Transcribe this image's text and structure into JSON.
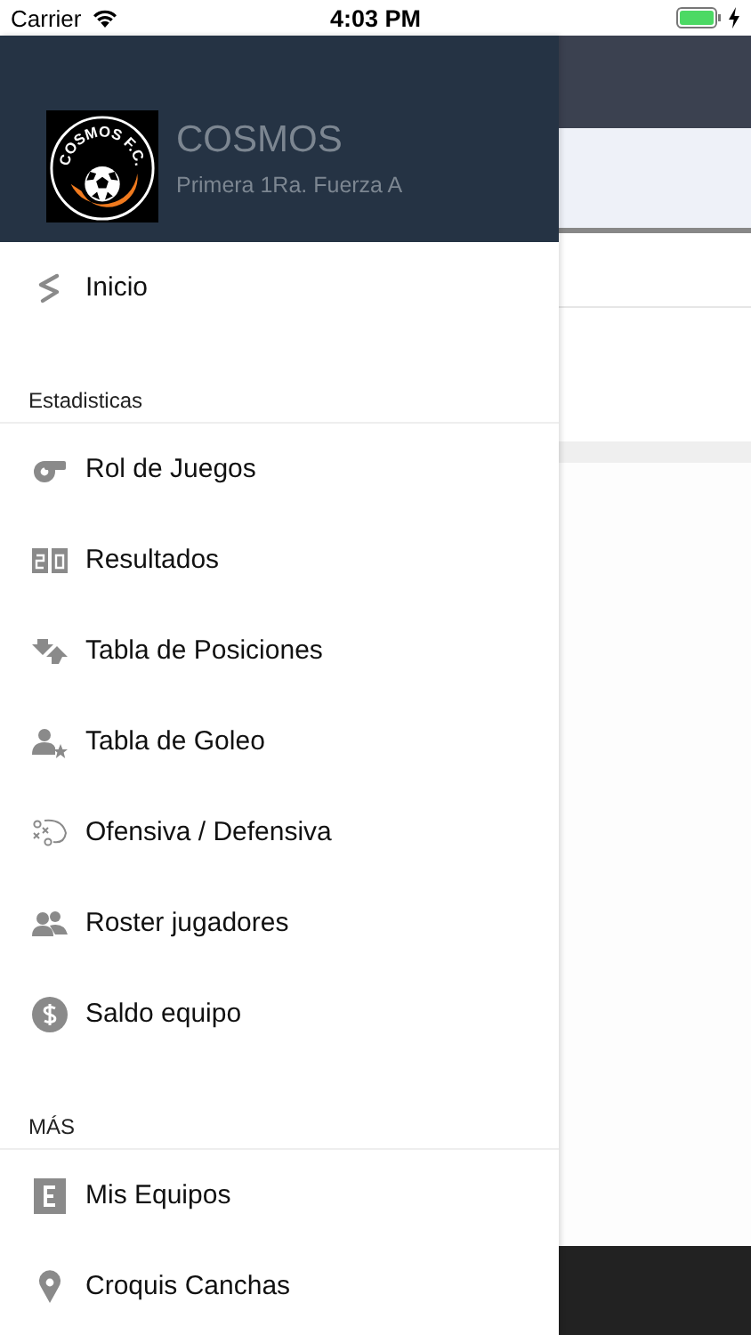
{
  "status_bar": {
    "carrier": "Carrier",
    "time": "4:03 PM"
  },
  "drawer": {
    "header": {
      "logo_text": "COSMOS F.C.",
      "team": "COSMOS",
      "division": "Primera 1Ra. Fuerza A"
    },
    "sections": [
      {
        "items": [
          {
            "label": "Inicio"
          }
        ]
      },
      {
        "title": "Estadisticas",
        "items": [
          {
            "label": "Rol de Juegos"
          },
          {
            "label": "Resultados"
          },
          {
            "label": "Tabla de Posiciones"
          },
          {
            "label": "Tabla de Goleo"
          },
          {
            "label": "Ofensiva / Defensiva"
          },
          {
            "label": "Roster jugadores"
          },
          {
            "label": "Saldo equipo"
          }
        ]
      },
      {
        "title": "MÁS",
        "items": [
          {
            "label": "Mis Equipos"
          },
          {
            "label": "Croquis Canchas"
          }
        ]
      }
    ]
  }
}
